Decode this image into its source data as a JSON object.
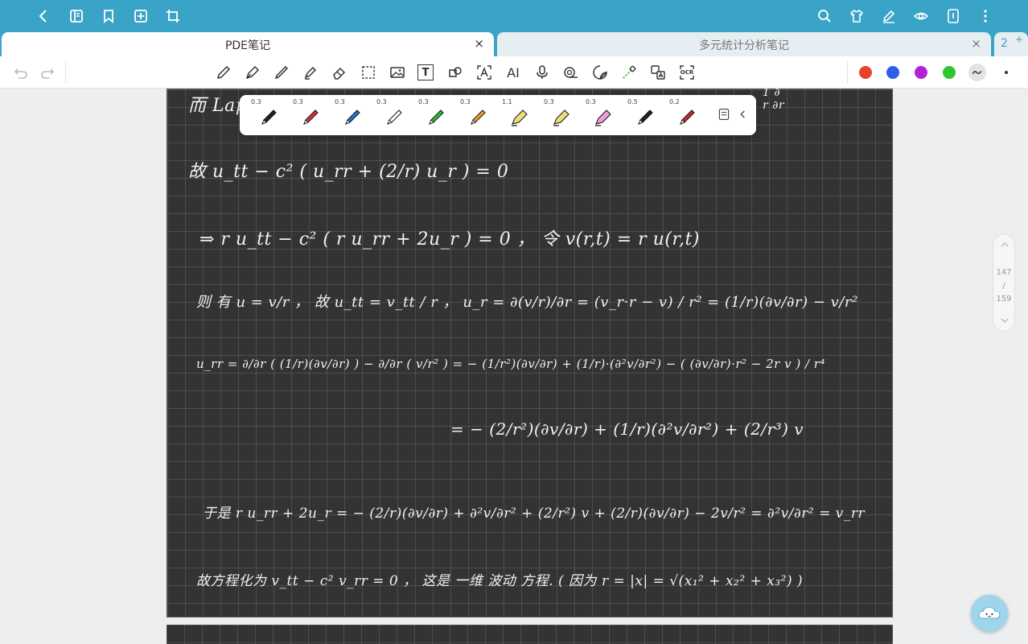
{
  "tabs": {
    "active": {
      "label": "PDE笔记",
      "close": "×"
    },
    "inactive": {
      "label": "多元统计分析笔记",
      "close": "×"
    },
    "count": "2",
    "add": "+"
  },
  "toolbar": {
    "text_tool": "T",
    "ai_tool": "AI",
    "ocr_tool": "OCR"
  },
  "colors": {
    "topbar": "#3aa3c8",
    "palette": [
      "#e8412e",
      "#2d5fe8",
      "#b520d6",
      "#2ec52e"
    ]
  },
  "pen_presets": [
    {
      "size": "0.3",
      "color": "#222222"
    },
    {
      "size": "0.3",
      "color": "#d9343a"
    },
    {
      "size": "0.3",
      "color": "#2a6fd6"
    },
    {
      "size": "0.3",
      "color": "#666666"
    },
    {
      "size": "0.3",
      "color": "#2ebd3a"
    },
    {
      "size": "0.3",
      "color": "#f0a12a"
    },
    {
      "size": "1.1",
      "color": "#e9e07a"
    },
    {
      "size": "0.3",
      "color": "#e9e07a"
    },
    {
      "size": "0.3",
      "color": "#e9a0d9"
    },
    {
      "size": "0.5",
      "color": "#222222"
    },
    {
      "size": "0.2",
      "color": "#c4283b"
    }
  ],
  "page_indicator": {
    "current": "147",
    "sep": "/",
    "total": "159"
  },
  "notes": {
    "line0": "而 Lap",
    "line0b": "1  ∂",
    "line0c": "r  ∂r",
    "line1": "故  u_tt − c² ( u_rr + (2/r) u_r ) = 0",
    "line2": "⇒   r u_tt − c² ( r u_rr + 2u_r ) = 0 ，  令  v(r,t) = r u(r,t)",
    "line3": "则 有  u = v/r ，  故  u_tt = v_tt / r ，   u_r = ∂(v/r)/∂r  =  (v_r·r − v) / r²   = (1/r)(∂v/∂r) − v/r²",
    "line4": "u_rr = ∂/∂r ( (1/r)(∂v/∂r) ) − ∂/∂r ( v/r² )  =  − (1/r²)(∂v/∂r) + (1/r)·(∂²v/∂r²) − ( (∂v/∂r)·r² − 2r v ) / r⁴",
    "line5": "=  − (2/r²)(∂v/∂r) + (1/r)(∂²v/∂r²) + (2/r³) v",
    "line6": "于是  r u_rr + 2u_r =  − (2/r)(∂v/∂r) + ∂²v/∂r² + (2/r²) v + (2/r)(∂v/∂r) − 2v/r²  =  ∂²v/∂r²  = v_rr",
    "line7": "故方程化为   v_tt  −  c² v_rr = 0 ，   这是 一维 波动 方程. ( 因为 r = |x| = √(x₁² + x₂² + x₃²) )"
  }
}
